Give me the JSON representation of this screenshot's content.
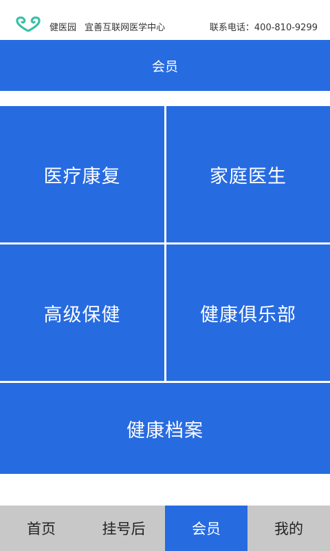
{
  "header": {
    "brand_name": "健医园",
    "org_name": "宜善互联网医学中心",
    "hotline": "联系电话：400-810-9299",
    "logo_icon": "heart-swirl-logo",
    "logo_color": "#3bbfa8"
  },
  "title_bar": {
    "title": "会员",
    "color": "#276be1"
  },
  "tiles": [
    {
      "label": "医疗康复"
    },
    {
      "label": "家庭医生"
    },
    {
      "label": "高级保健"
    },
    {
      "label": "健康俱乐部"
    },
    {
      "label": "健康档案"
    }
  ],
  "bottom_nav": {
    "items": [
      {
        "label": "首页"
      },
      {
        "label": "挂号后"
      },
      {
        "label": "会员"
      },
      {
        "label": "我的"
      }
    ],
    "active_label": "会员",
    "active_color": "#276be1",
    "inactive_color": "#c8c8c8"
  }
}
